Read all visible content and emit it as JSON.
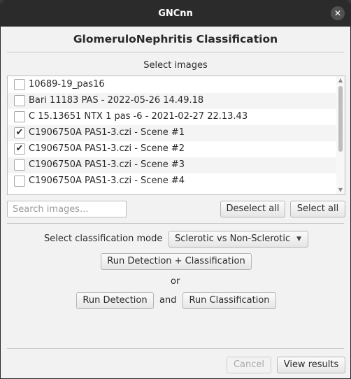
{
  "window": {
    "title": "GNCnn",
    "close_glyph": "✕"
  },
  "heading": "GlomeruloNephritis Classification",
  "select_images_label": "Select images",
  "images": [
    {
      "label": "10689-19_pas16",
      "checked": false
    },
    {
      "label": "Bari 11183 PAS - 2022-05-26 14.49.18",
      "checked": false
    },
    {
      "label": "C 15.13651 NTX 1 pas -6 - 2021-02-27 22.13.43",
      "checked": false
    },
    {
      "label": "C1906750A PAS1-3.czi - Scene #1",
      "checked": true
    },
    {
      "label": "C1906750A PAS1-3.czi - Scene #2",
      "checked": true
    },
    {
      "label": "C1906750A PAS1-3.czi - Scene #3",
      "checked": false
    },
    {
      "label": "C1906750A PAS1-3.czi - Scene #4",
      "checked": false
    }
  ],
  "search": {
    "placeholder": "Search images...",
    "value": ""
  },
  "buttons": {
    "deselect_all": "Deselect all",
    "select_all": "Select all",
    "run_detection_classification": "Run Detection + Classification",
    "run_detection": "Run Detection",
    "run_classification": "Run Classification",
    "cancel": "Cancel",
    "view_results": "View results"
  },
  "mode": {
    "label": "Select classification mode",
    "selected": "Sclerotic vs Non-Sclerotic"
  },
  "or_text": "or",
  "and_text": "and",
  "check_glyph": "✔",
  "icons": {
    "close": "close-icon",
    "check": "checkmark-icon",
    "dropdown": "caret-down-icon",
    "scroll_up": "chevron-up-icon",
    "scroll_down": "chevron-down-icon"
  }
}
